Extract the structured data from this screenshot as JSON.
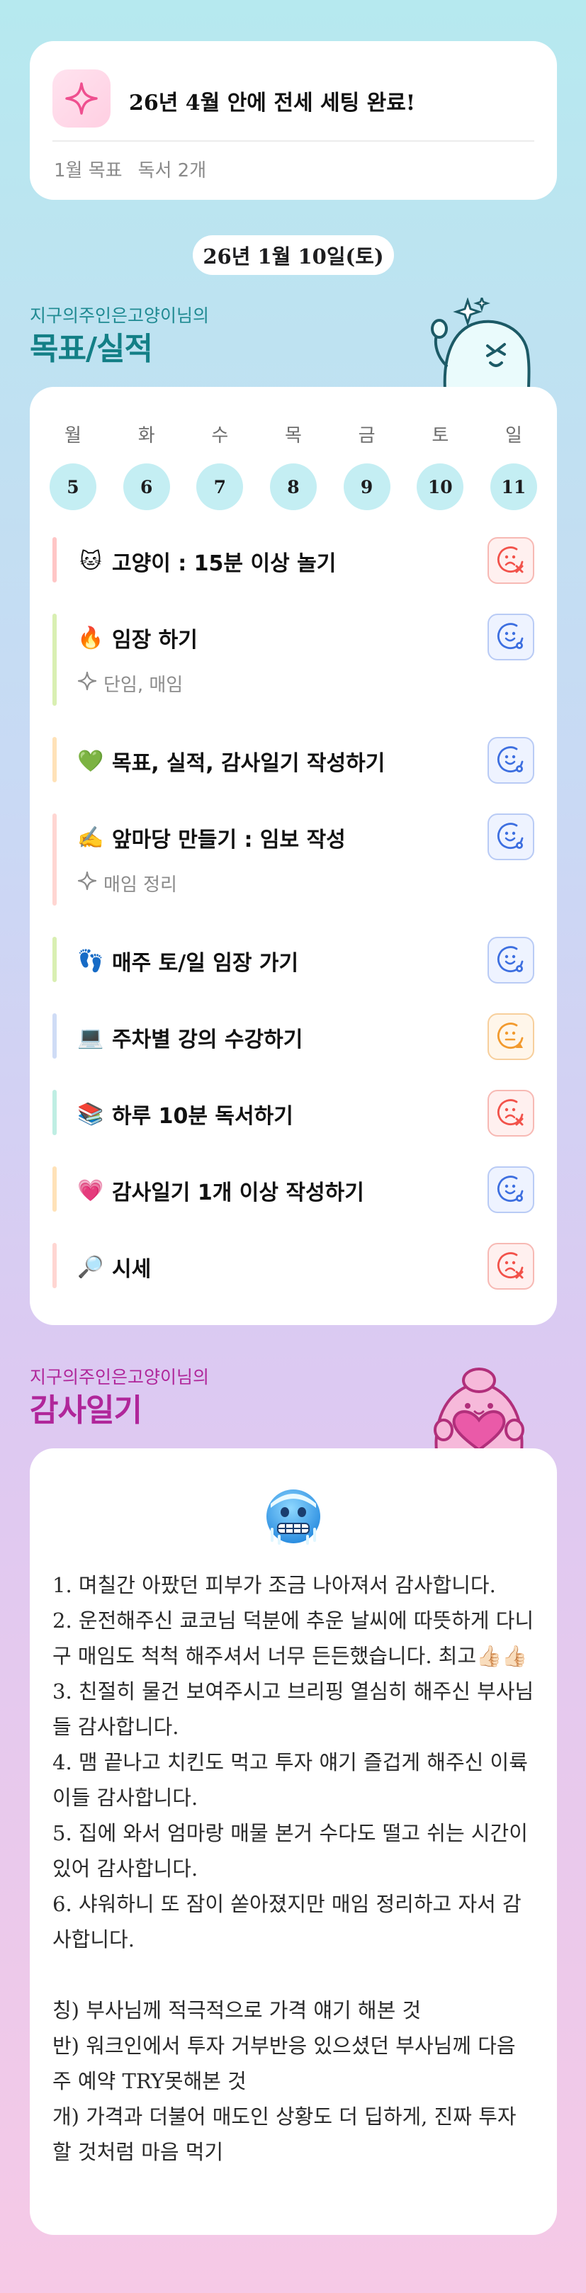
{
  "goal": {
    "title": "26년 4월 안에 전세 세팅 완료!",
    "month_label": "1월 목표",
    "month_value": "독서 2개"
  },
  "date": "26년 1월 10일(토)",
  "goals_section": {
    "subtitle": "지구의주인은고양이님의",
    "title": "목표/실적",
    "title_color": "#137f86"
  },
  "week": {
    "days": [
      {
        "name": "월",
        "num": "5"
      },
      {
        "name": "화",
        "num": "6"
      },
      {
        "name": "수",
        "num": "7"
      },
      {
        "name": "목",
        "num": "8"
      },
      {
        "name": "금",
        "num": "9"
      },
      {
        "name": "토",
        "num": "10"
      },
      {
        "name": "일",
        "num": "11"
      }
    ]
  },
  "tasks": [
    {
      "emoji": "🐱",
      "label": "고양이 : 15분 이상 놀기",
      "bar_color": "#ffc6c6",
      "status": "fail",
      "status_icon": "sad-face-x-icon"
    },
    {
      "emoji": "🔥",
      "label": "임장 하기",
      "sub": "단임, 매임",
      "bar_color": "#d9efb2",
      "status": "done",
      "status_icon": "smile-face-check-icon"
    },
    {
      "emoji": "💚",
      "label": "목표, 실적, 감사일기 작성하기",
      "bar_color": "#ffe2b8",
      "status": "done",
      "status_icon": "smile-face-check-icon"
    },
    {
      "emoji": "✍️",
      "label": "앞마당 만들기 : 임보 작성",
      "sub": "매임 정리",
      "bar_color": "#ffd6d2",
      "status": "done",
      "status_icon": "smile-face-check-icon"
    },
    {
      "emoji": "👣",
      "label": "매주 토/일 임장 가기",
      "bar_color": "#d9efb2",
      "status": "done",
      "status_icon": "smile-face-check-icon"
    },
    {
      "emoji": "💻",
      "label": "주차별 강의 수강하기",
      "bar_color": "#cfdcf6",
      "status": "partial",
      "status_icon": "neutral-face-warning-icon"
    },
    {
      "emoji": "📚",
      "label": "하루 10분 독서하기",
      "bar_color": "#bfeee3",
      "status": "fail",
      "status_icon": "sad-face-x-icon"
    },
    {
      "emoji": "💗",
      "label": "감사일기 1개 이상 작성하기",
      "bar_color": "#ffe2b8",
      "status": "done",
      "status_icon": "smile-face-check-icon"
    },
    {
      "emoji": "🔎",
      "label": "시세",
      "bar_color": "#ffd6d2",
      "status": "fail",
      "status_icon": "sad-face-x-icon"
    }
  ],
  "gratitude_section": {
    "subtitle": "지구의주인은고양이님의",
    "title": "감사일기",
    "title_color": "#b0269a"
  },
  "gratitude": {
    "face_icon": "freezing-face-icon",
    "lines": [
      "1. 며칠간 아팠던 피부가 조금 나아져서 감사합니다.",
      "2. 운전해주신 쿄코님 덕분에 추운 날씨에 따뜻하게 다니구 매임도 척척 해주셔서 너무 든든했습니다. 최고👍🏻👍🏻",
      "3. 친절히 물건 보여주시고 브리핑 열심히 해주신 부사님들 감사합니다.",
      "4. 맴 끝나고 치킨도 먹고 투자 얘기 즐겁게 해주신 이륙이들 감사합니다.",
      "5. 집에 와서 엄마랑 매물 본거 수다도 떨고 쉬는 시간이 있어 감사합니다.",
      "6. 샤워하니 또 잠이 쏟아졌지만 매임 정리하고 자서 감사합니다.",
      "",
      "칭) 부사님께 적극적으로 가격 얘기 해본 것",
      "반) 워크인에서 투자 거부반응 있으셨던 부사님께 다음주 예약 TRY못해본 것",
      "개) 가격과 더불어 매도인 상황도 더 딥하게, 진짜 투자할 것처럼 마음 먹기"
    ]
  },
  "colors": {
    "fail": "#f2524a",
    "done": "#3d6fe0",
    "partial": "#f29a2e"
  }
}
